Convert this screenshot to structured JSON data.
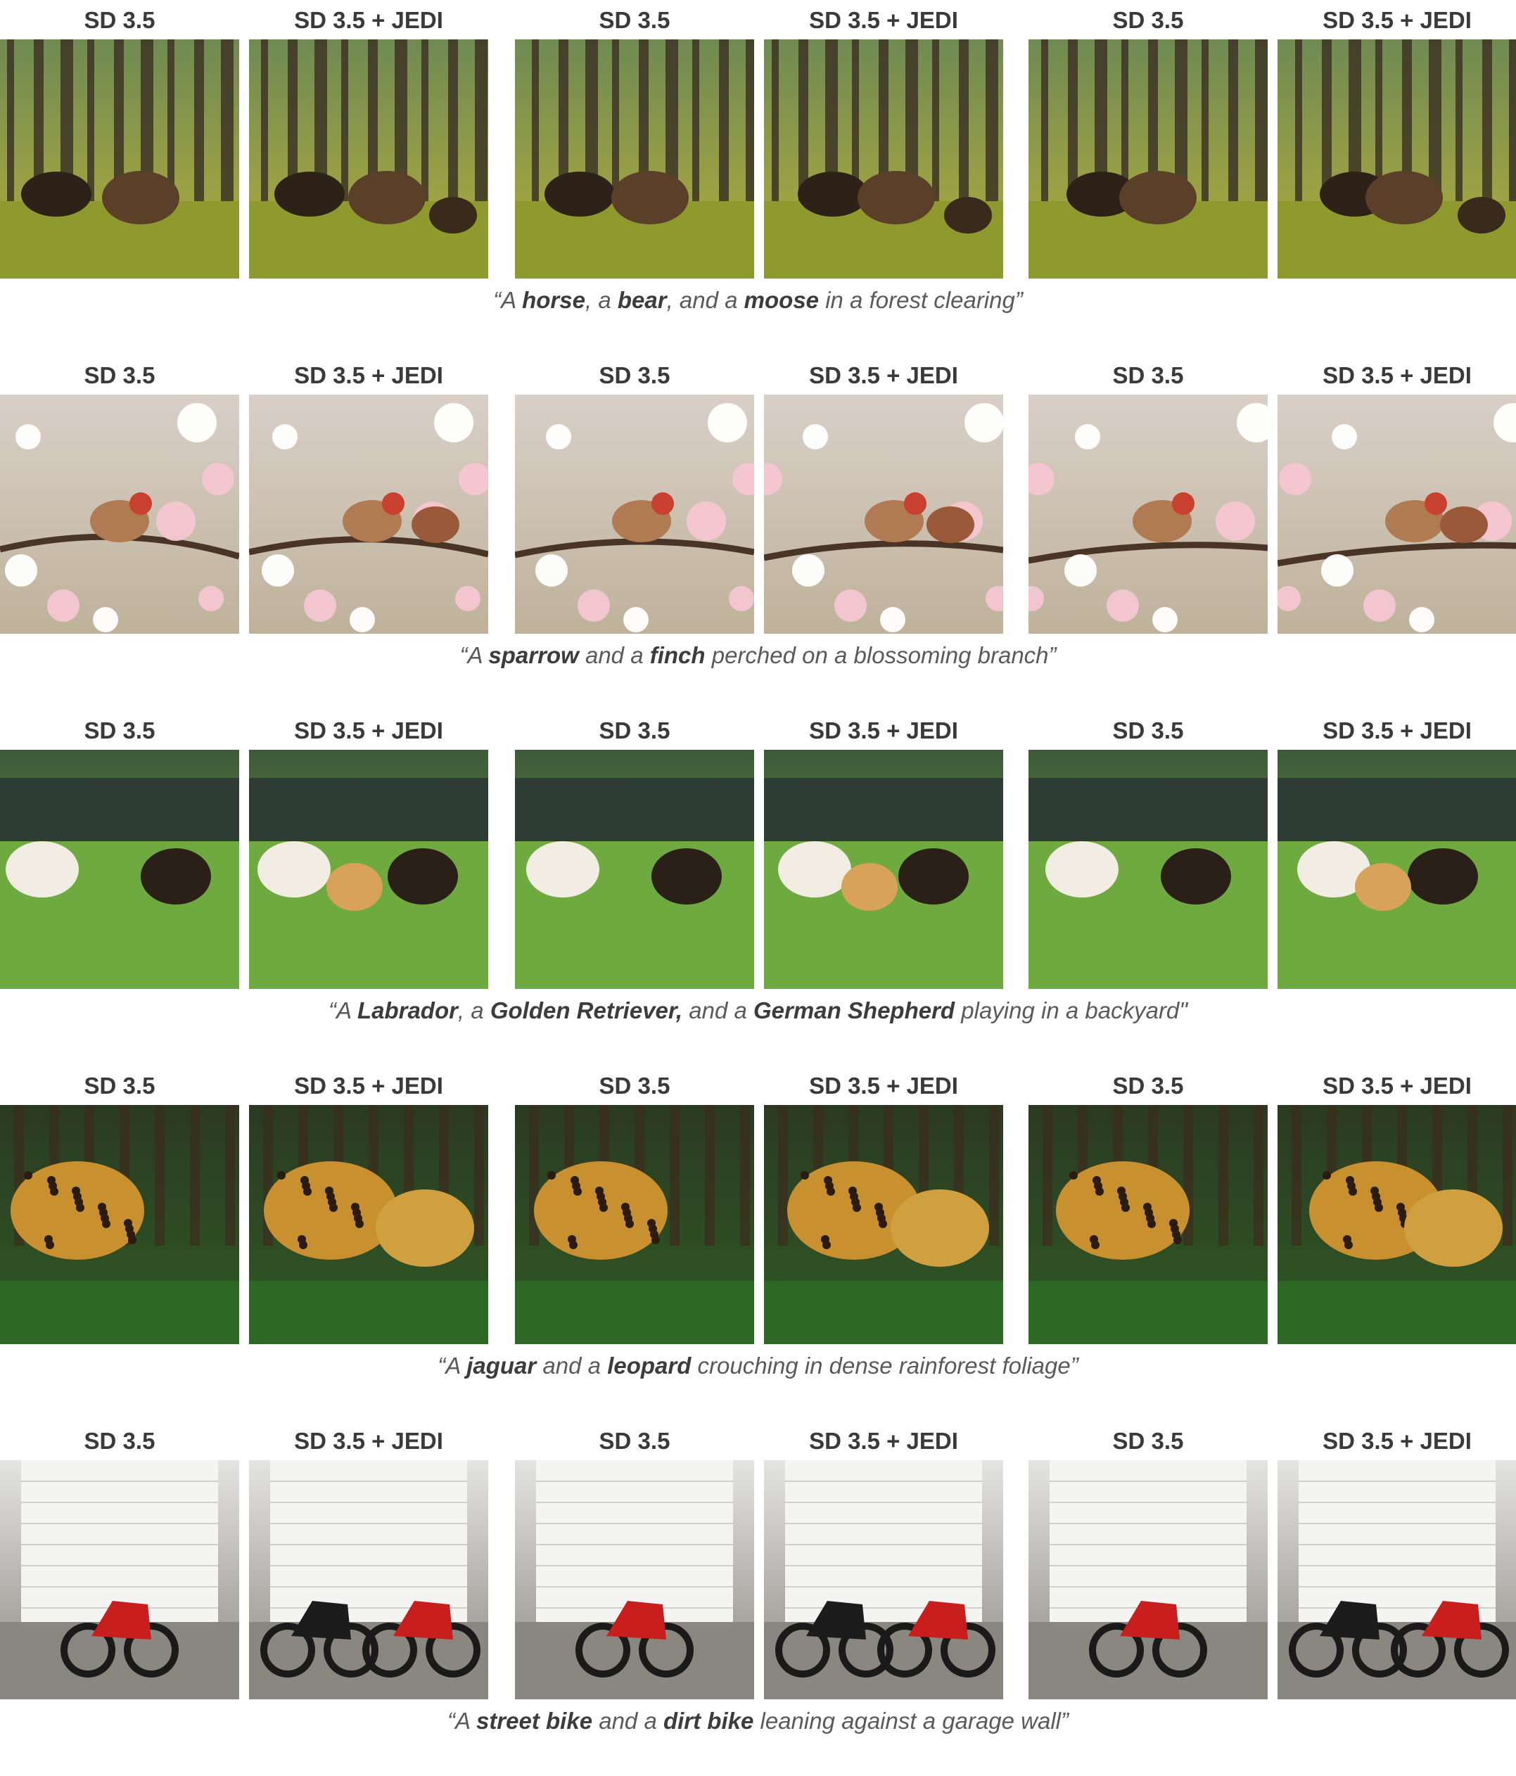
{
  "column_labels": [
    "SD 3.5",
    "SD 3.5 + JEDI",
    "SD 3.5",
    "SD 3.5 + JEDI",
    "SD 3.5",
    "SD 3.5 + JEDI"
  ],
  "rows": [
    {
      "scene": "forest",
      "colors": {
        "top": "#6f8a52",
        "bottom": "#b5ae3c",
        "accent": "#3a2a1c"
      },
      "caption": [
        {
          "t": "“A ",
          "b": false
        },
        {
          "t": "horse",
          "b": true
        },
        {
          "t": ", a ",
          "b": false
        },
        {
          "t": "bear",
          "b": true
        },
        {
          "t": ", and a ",
          "b": false
        },
        {
          "t": "moose",
          "b": true
        },
        {
          "t": " in a forest clearing”",
          "b": false
        }
      ]
    },
    {
      "scene": "blossom",
      "colors": {
        "top": "#d9cfc8",
        "bottom": "#bfb29a",
        "accent": "#9a5a3a"
      },
      "caption": [
        {
          "t": "“A ",
          "b": false
        },
        {
          "t": "sparrow",
          "b": true
        },
        {
          "t": " and a ",
          "b": false
        },
        {
          "t": "finch",
          "b": true
        },
        {
          "t": " perched on a blossoming branch”",
          "b": false
        }
      ]
    },
    {
      "scene": "backyard",
      "colors": {
        "top": "#3e5a3a",
        "bottom": "#6ea842",
        "accent": "#1e1a16"
      },
      "caption": [
        {
          "t": "“A ",
          "b": false
        },
        {
          "t": "Labrador",
          "b": true
        },
        {
          "t": ", a ",
          "b": false
        },
        {
          "t": "Golden Retriever,",
          "b": true
        },
        {
          "t": " and a ",
          "b": false
        },
        {
          "t": "German Shepherd",
          "b": true
        },
        {
          "t": " playing in a backyard\"",
          "b": false
        }
      ]
    },
    {
      "scene": "jungle",
      "colors": {
        "top": "#2b3a22",
        "bottom": "#2f5a24",
        "accent": "#c8902e"
      },
      "caption": [
        {
          "t": "“A ",
          "b": false
        },
        {
          "t": "jaguar",
          "b": true
        },
        {
          "t": " and a ",
          "b": false
        },
        {
          "t": "leopard",
          "b": true
        },
        {
          "t": " crouching in dense rainforest foliage”",
          "b": false
        }
      ]
    },
    {
      "scene": "garage",
      "colors": {
        "top": "#e4e4e2",
        "bottom": "#8a8680",
        "accent": "#c81e1e"
      },
      "caption": [
        {
          "t": "“A ",
          "b": false
        },
        {
          "t": "street bike",
          "b": true
        },
        {
          "t": " and a ",
          "b": false
        },
        {
          "t": "dirt bike",
          "b": true
        },
        {
          "t": " leaning against a garage wall”",
          "b": false
        }
      ]
    }
  ]
}
